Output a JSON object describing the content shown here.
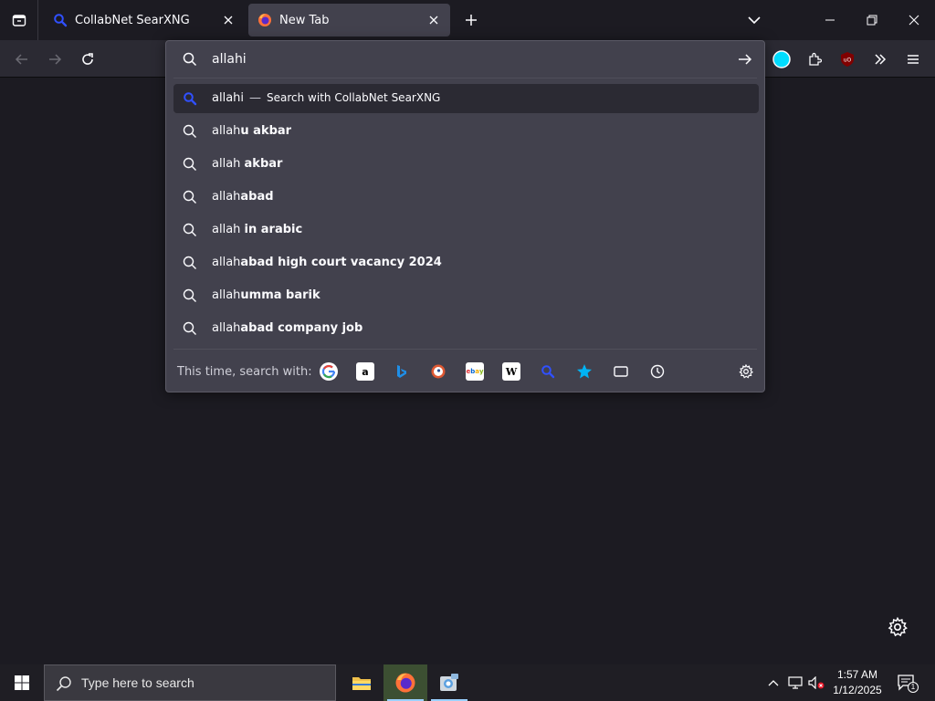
{
  "tabs": [
    {
      "title": "CollabNet SearXNG"
    },
    {
      "title": "New Tab"
    }
  ],
  "urlbar": {
    "value": "allahi"
  },
  "heuristic": {
    "query": "allahi",
    "dash": "—",
    "action": "Search with CollabNet SearXNG"
  },
  "suggestions": [
    {
      "prefix": "allah",
      "bold": "u akbar"
    },
    {
      "prefix": "allah ",
      "bold": "akbar"
    },
    {
      "prefix": "allah",
      "bold": "abad"
    },
    {
      "prefix": "allah ",
      "bold": "in arabic"
    },
    {
      "prefix": "allah",
      "bold": "abad high court vacancy 2024"
    },
    {
      "prefix": "allah",
      "bold": "umma barik"
    },
    {
      "prefix": "allah",
      "bold": "abad company job"
    }
  ],
  "oneoff": {
    "label": "This time, search with:",
    "engines": [
      "google-icon",
      "amazon-icon",
      "bing-icon",
      "duckduckgo-icon",
      "ebay-icon",
      "wikipedia-icon",
      "searxng-icon",
      "bookmarks-icon",
      "tabs-icon",
      "history-icon"
    ]
  },
  "taskbar": {
    "search_placeholder": "Type here to search",
    "time": "1:57 AM",
    "date": "1/12/2025",
    "notification_count": "1"
  },
  "colors": {
    "accent": "#00ddff",
    "searx_blue": "#3050ff"
  }
}
